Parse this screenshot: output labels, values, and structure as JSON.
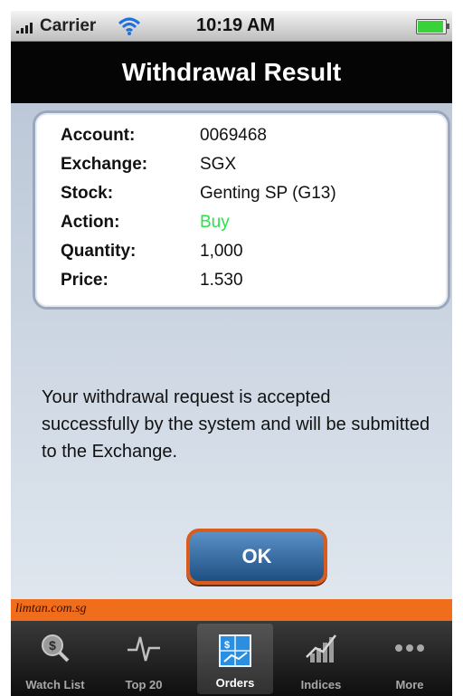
{
  "status_bar": {
    "carrier": "Carrier",
    "time": "10:19 AM",
    "battery_level": 1.0
  },
  "nav_bar": {
    "title": "Withdrawal Result"
  },
  "details": [
    {
      "label": "Account:",
      "value": "0069468"
    },
    {
      "label": "Exchange:",
      "value": "SGX"
    },
    {
      "label": "Stock:",
      "value": "Genting SP (G13)"
    },
    {
      "label": "Action:",
      "value": "Buy"
    },
    {
      "label": "Quantity:",
      "value": "1,000"
    },
    {
      "label": "Price:",
      "value": "1.530"
    }
  ],
  "message": "Your withdrawal request is accepted successfully by the system and will be submitted to the Exchange.",
  "ok_button": "OK",
  "banner": "limtan.com.sg",
  "tabs": [
    {
      "label": "Watch List",
      "icon": "search-dollar-icon"
    },
    {
      "label": "Top 20",
      "icon": "pulse-icon"
    },
    {
      "label": "Orders",
      "icon": "orders-icon",
      "active": true
    },
    {
      "label": "Indices",
      "icon": "chart-icon"
    },
    {
      "label": "More",
      "icon": "more-icon"
    }
  ],
  "colors": {
    "action_buy": "#2ce14a",
    "banner": "#ef6d1b",
    "ok_button_border": "#d85c1e"
  }
}
